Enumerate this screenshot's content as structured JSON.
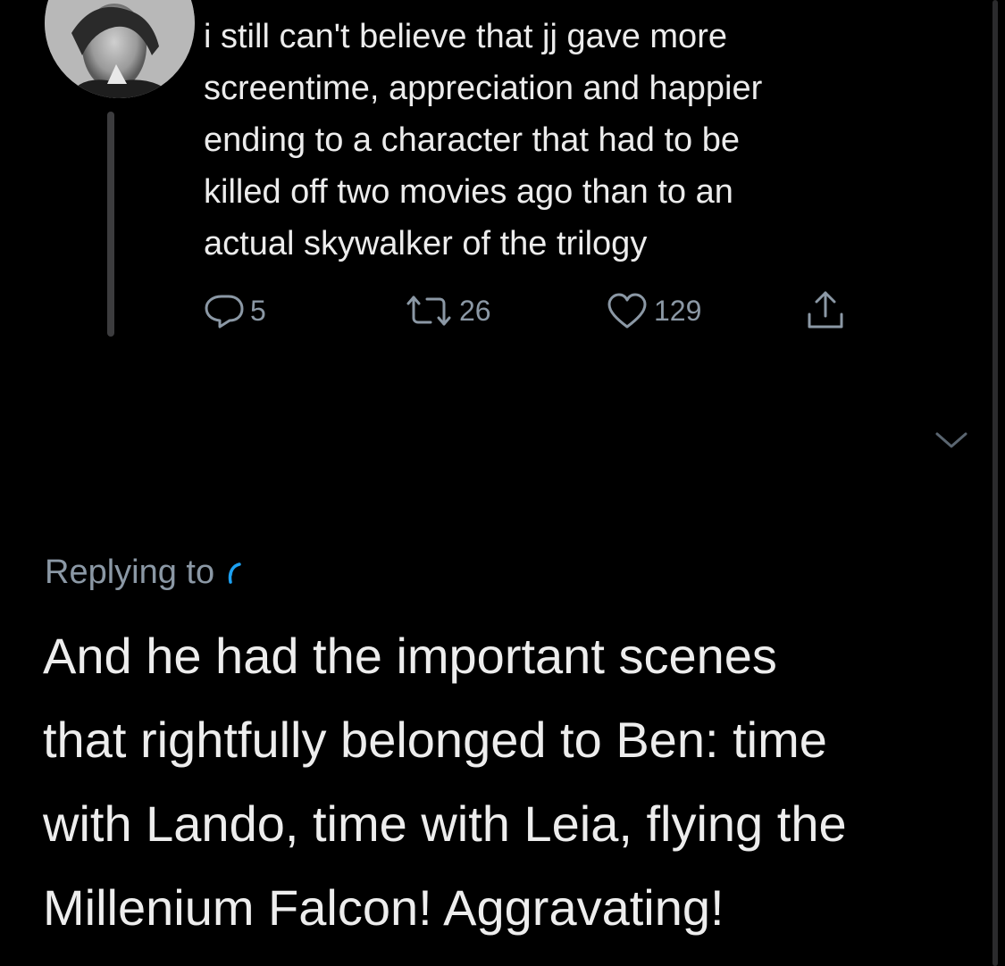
{
  "parent_tweet": {
    "text": "i still can't believe that jj gave more\nscreentime, appreciation and happier\nending to a character that had to be\nkilled off two movies ago than to an\nactual skywalker of the trilogy",
    "actions": {
      "reply_count": "5",
      "retweet_count": "26",
      "like_count": "129"
    }
  },
  "reply": {
    "replying_to_label": "Replying to",
    "text": "And he had the important scenes\nthat rightfully belonged to Ben: time\nwith Lando, time with Leia, flying the\nMillenium Falcon! Aggravating!"
  },
  "colors": {
    "background": "#000000",
    "text": "#ececec",
    "secondary": "#8b98a5",
    "accent": "#1da1f2",
    "thread_line": "#3c3c3e"
  },
  "icons": {
    "reply": "reply-icon",
    "retweet": "retweet-icon",
    "like": "heart-icon",
    "share": "share-icon",
    "more": "chevron-down-icon"
  }
}
